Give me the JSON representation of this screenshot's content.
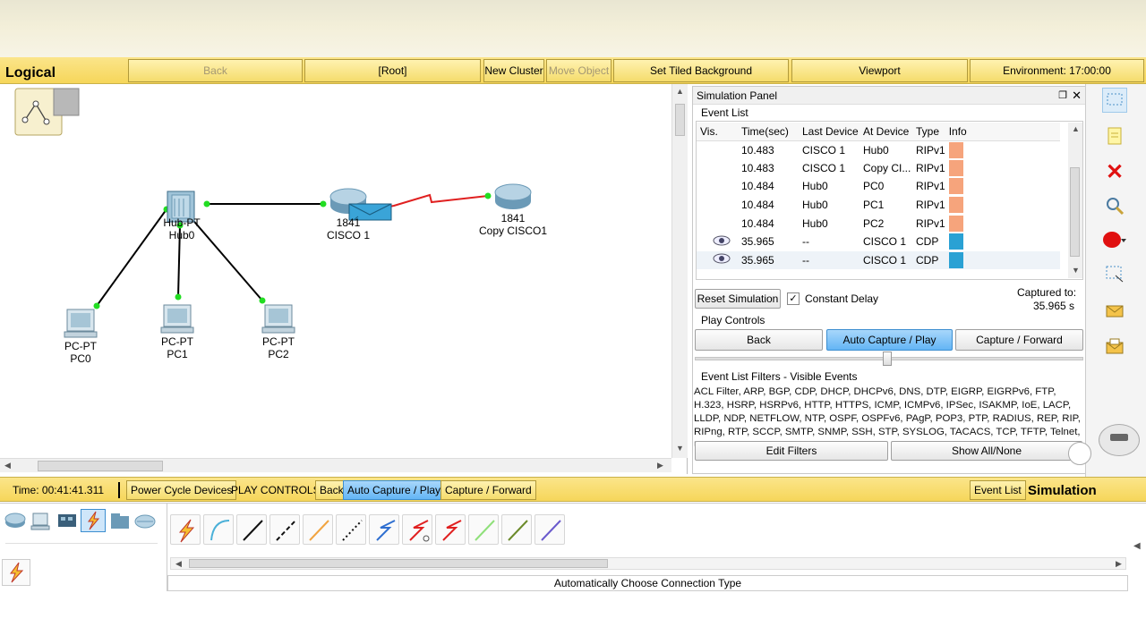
{
  "topbar": {
    "mode_label": "Logical",
    "back": "Back",
    "root": "[Root]",
    "new_cluster": "New Cluster",
    "move_object": "Move Object",
    "set_tiled_background": "Set Tiled Background",
    "viewport": "Viewport",
    "environment": "Environment: 17:00:00"
  },
  "topology": {
    "hub": {
      "type": "Hub-PT",
      "name": "Hub0"
    },
    "router1": {
      "type": "1841",
      "name": "CISCO 1"
    },
    "router2": {
      "type": "1841",
      "name": "Copy CISCO1"
    },
    "pc0": {
      "type": "PC-PT",
      "name": "PC0"
    },
    "pc1": {
      "type": "PC-PT",
      "name": "PC1"
    },
    "pc2": {
      "type": "PC-PT",
      "name": "PC2"
    }
  },
  "sim_panel": {
    "title": "Simulation Panel",
    "event_list_label": "Event List",
    "columns": [
      "Vis.",
      "Time(sec)",
      "Last Device",
      "At Device",
      "Type",
      "Info"
    ],
    "events": [
      {
        "vis": "",
        "time": "10.483",
        "last": "CISCO 1",
        "at": "Hub0",
        "type": "RIPv1",
        "color": "#f6a47c"
      },
      {
        "vis": "",
        "time": "10.483",
        "last": "CISCO 1",
        "at": "Copy CI...",
        "type": "RIPv1",
        "color": "#f6a47c"
      },
      {
        "vis": "",
        "time": "10.484",
        "last": "Hub0",
        "at": "PC0",
        "type": "RIPv1",
        "color": "#f6a47c"
      },
      {
        "vis": "",
        "time": "10.484",
        "last": "Hub0",
        "at": "PC1",
        "type": "RIPv1",
        "color": "#f6a47c"
      },
      {
        "vis": "",
        "time": "10.484",
        "last": "Hub0",
        "at": "PC2",
        "type": "RIPv1",
        "color": "#f6a47c"
      },
      {
        "vis": "eye",
        "time": "35.965",
        "last": "--",
        "at": "CISCO 1",
        "type": "CDP",
        "color": "#2aa1d4"
      },
      {
        "vis": "eye",
        "time": "35.965",
        "last": "--",
        "at": "CISCO 1",
        "type": "CDP",
        "color": "#2aa1d4"
      }
    ],
    "reset_simulation": "Reset Simulation",
    "constant_delay": "Constant Delay",
    "captured_to_label": "Captured to:",
    "captured_to_value": "35.965 s",
    "play_controls_label": "Play Controls",
    "back": "Back",
    "auto_capture_play": "Auto Capture / Play",
    "capture_forward": "Capture / Forward",
    "filters_label": "Event List Filters - Visible Events",
    "filters_text": "ACL Filter, ARP, BGP, CDP, DHCP, DHCPv6, DNS, DTP, EIGRP, EIGRPv6, FTP, H.323, HSRP, HSRPv6, HTTP, HTTPS, ICMP, ICMPv6, IPSec, ISAKMP, IoE, LACP, LLDP, NDP, NETFLOW, NTP, OSPF, OSPFv6, PAgP, POP3, PTP, RADIUS, REP, RIP, RIPng, RTP, SCCP, SMTP, SNMP, SSH, STP, SYSLOG, TACACS, TCP, TFTP, Telnet, UDP, VTP",
    "edit_filters": "Edit Filters",
    "show_all_none": "Show All/None"
  },
  "bottombar": {
    "time": "Time: 00:41:41.311",
    "power_cycle": "Power Cycle Devices",
    "play_controls": "PLAY CONTROLS:",
    "back": "Back",
    "auto_capture_play": "Auto Capture / Play",
    "capture_forward": "Capture / Forward",
    "event_list": "Event List",
    "simulation": "Simulation"
  },
  "toolbox": {
    "status": "Automatically Choose Connection Type"
  },
  "colors": {
    "accent_yellow": "#f6d65a",
    "active_blue": "#63b5f5",
    "link_black": "#000000",
    "link_red": "#e02020",
    "port_green": "#22dd22"
  }
}
